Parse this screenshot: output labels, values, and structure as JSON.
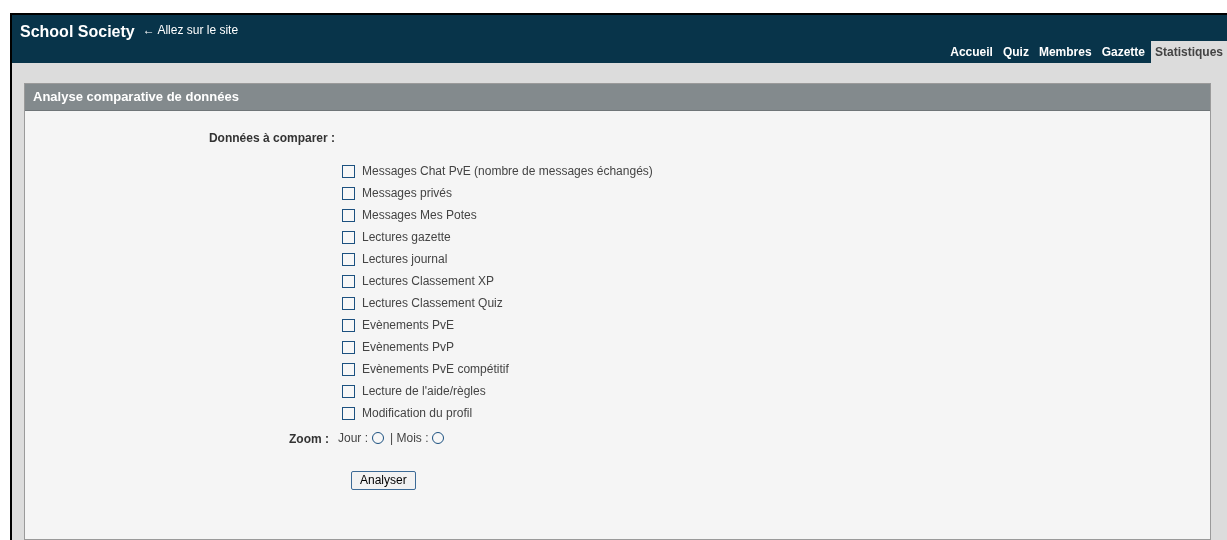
{
  "header": {
    "title": "School Society",
    "site_link": "← Allez sur le site"
  },
  "tabs": [
    {
      "label": "Accueil",
      "selected": false
    },
    {
      "label": "Quiz",
      "selected": false
    },
    {
      "label": "Membres",
      "selected": false
    },
    {
      "label": "Gazette",
      "selected": false
    },
    {
      "label": "Statistiques",
      "selected": true
    }
  ],
  "panel": {
    "title": "Analyse comparative de données",
    "data_label": "Données à comparer :",
    "options": [
      {
        "label": "Messages Chat PvE (nombre de messages échangés)",
        "checked": false
      },
      {
        "label": "Messages privés",
        "checked": false
      },
      {
        "label": "Messages Mes Potes",
        "checked": false
      },
      {
        "label": "Lectures gazette",
        "checked": false
      },
      {
        "label": "Lectures journal",
        "checked": false
      },
      {
        "label": "Lectures Classement XP",
        "checked": false
      },
      {
        "label": "Lectures Classement Quiz",
        "checked": false
      },
      {
        "label": "Evènements PvE",
        "checked": false
      },
      {
        "label": "Evènements PvP",
        "checked": false
      },
      {
        "label": "Evènements PvE compétitif",
        "checked": false
      },
      {
        "label": "Lecture de l'aide/règles",
        "checked": false
      },
      {
        "label": "Modification du profil",
        "checked": false
      }
    ],
    "zoom_label": "Zoom :",
    "zoom_options": [
      {
        "label": "Jour :",
        "selected": false
      },
      {
        "label": "| Mois :",
        "selected": false
      }
    ],
    "button": "Analyser"
  }
}
